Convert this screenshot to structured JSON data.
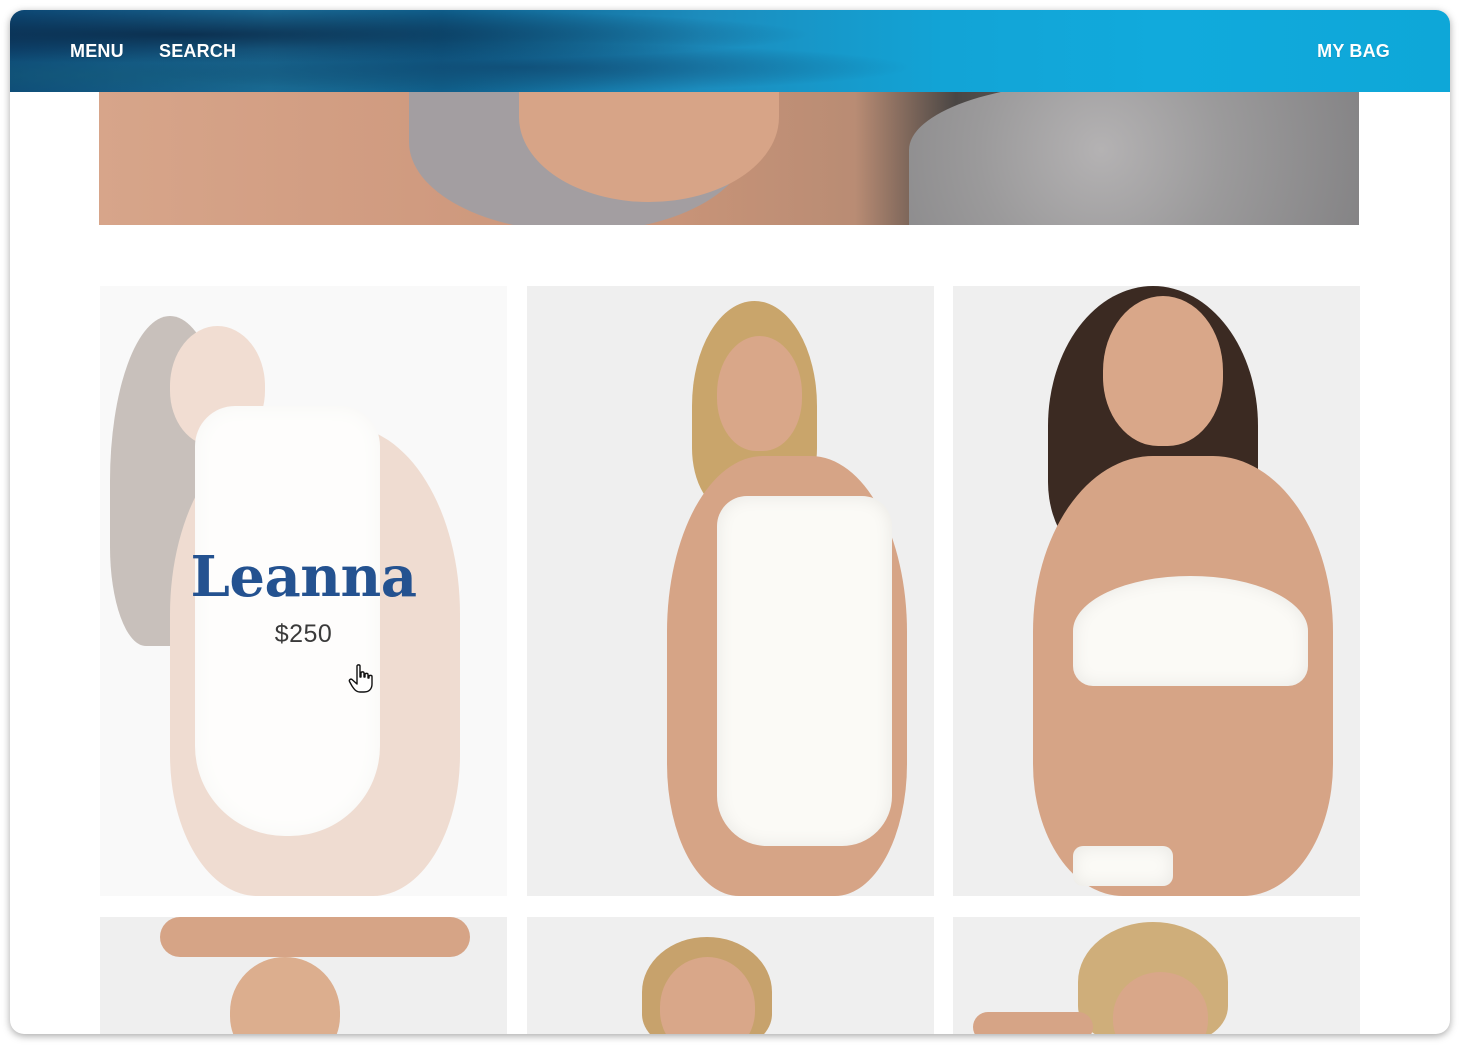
{
  "header": {
    "menu_label": "MENU",
    "search_label": "SEARCH",
    "bag_label": "MY BAG"
  },
  "products": [
    {
      "name": "Leanna",
      "price": "$250",
      "hovered": true
    },
    {
      "name": "",
      "price": ""
    },
    {
      "name": "",
      "price": ""
    },
    {
      "name": "",
      "price": ""
    },
    {
      "name": "",
      "price": ""
    },
    {
      "name": "",
      "price": ""
    }
  ],
  "colors": {
    "header_accent": "#11aadc",
    "product_name": "#245290",
    "card_bg": "#efefef"
  }
}
